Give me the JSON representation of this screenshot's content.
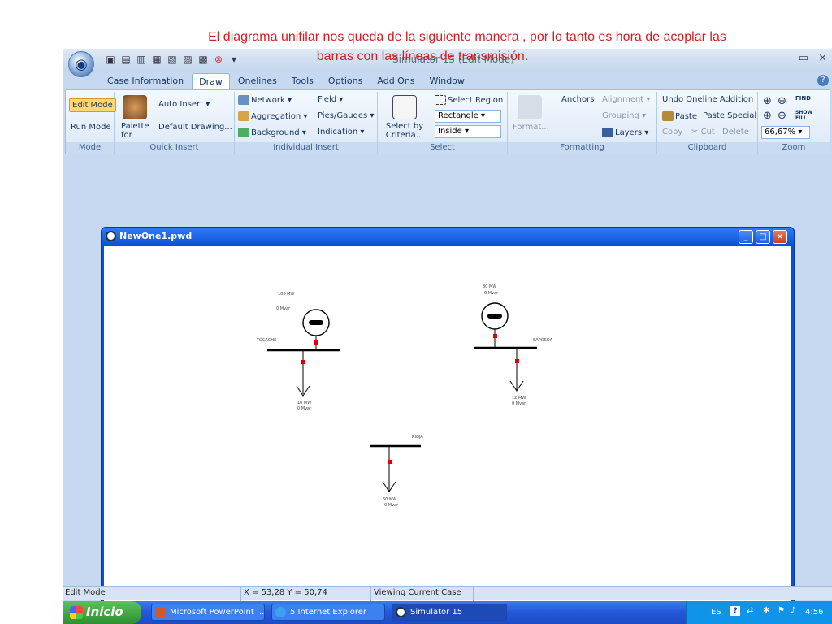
{
  "caption": {
    "line1": "El diagrama unifilar nos queda de la siguiente manera , por lo tanto es hora de acoplar las",
    "line2": "barras con las líneas de transmisión."
  },
  "app": {
    "title": "Simulator 15 (Edit Mode)"
  },
  "tabs": [
    "Case Information",
    "Draw",
    "Onelines",
    "Tools",
    "Options",
    "Add Ons",
    "Window"
  ],
  "ribbon": {
    "mode": {
      "edit_mode": "Edit Mode",
      "run_mode": "Run Mode",
      "label": "Mode"
    },
    "quick_insert": {
      "auto_insert": "Auto Insert",
      "palette_for": "Palette for",
      "default_drawing": "Default Drawing...",
      "label": "Quick Insert"
    },
    "individual_insert": {
      "network": "Network",
      "aggregation": "Aggregation",
      "background": "Background",
      "field": "Field",
      "pies_gauges": "Pies/Gauges",
      "indication": "Indication",
      "label": "Individual Insert"
    },
    "select": {
      "select_by_criteria": "Select by Criteria...",
      "select_region": "Select Region",
      "rectangle": "Rectangle",
      "inside": "Inside",
      "label": "Select"
    },
    "formatting": {
      "format": "Format...",
      "anchors": "Anchors",
      "alignment": "Alignment",
      "grouping": "Grouping",
      "layers": "Layers",
      "label": "Formatting"
    },
    "clipboard": {
      "undo": "Undo Oneline Addition",
      "paste": "Paste",
      "paste_special": "Paste Special",
      "copy": "Copy",
      "cut": "Cut",
      "delete": "Delete",
      "label": "Clipboard"
    },
    "zoom": {
      "value": "66,67%",
      "find": "FIND",
      "show_fill": "SHOW FILL",
      "label": "Zoom"
    }
  },
  "document": {
    "title": "NewOne1.pwd",
    "buses": [
      {
        "name": "TOCACHE",
        "gen": "100 MW",
        "gen_mvar": "0 Mvar",
        "load": "10 MW",
        "load_mvar": "0 Mvar"
      },
      {
        "name": "SAPOSOA",
        "gen": "80 MW",
        "gen_mvar": "0 Mvar",
        "load": "12 MW",
        "load_mvar": "0 Mvar"
      },
      {
        "name": "RIOJA",
        "load": "60 MW",
        "load_mvar": "0 Mvar"
      }
    ]
  },
  "statusbar": {
    "mode": "Edit Mode",
    "coords": "X = 53,28 Y = 50,74",
    "viewing": "Viewing Current Case"
  },
  "taskbar": {
    "start": "Inicio",
    "tasks": [
      "Microsoft PowerPoint ...",
      "5 Internet Explorer",
      "Simulator 15"
    ],
    "tray": {
      "lang": "ES",
      "time": "4:56"
    }
  }
}
